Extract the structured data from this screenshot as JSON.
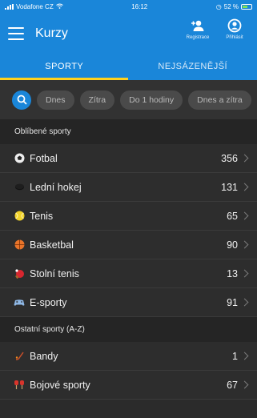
{
  "status_bar": {
    "carrier": "Vodafone CZ",
    "time": "16:12",
    "battery": "52 %"
  },
  "app_bar": {
    "title": "Kurzy",
    "register_label": "Registrace",
    "login_label": "Přihlásit"
  },
  "tabs": [
    {
      "label": "SPORTY",
      "active": true
    },
    {
      "label": "NEJSÁZENĚJŠÍ",
      "active": false
    }
  ],
  "filters": [
    "Dnes",
    "Zítra",
    "Do 1 hodiny",
    "Dnes a zítra"
  ],
  "favorite_sports": {
    "header": "Oblíbené sporty",
    "items": [
      {
        "label": "Fotbal",
        "count": "356",
        "icon": "soccer-ball-icon"
      },
      {
        "label": "Lední hokej",
        "count": "131",
        "icon": "hockey-puck-icon"
      },
      {
        "label": "Tenis",
        "count": "65",
        "icon": "tennis-ball-icon"
      },
      {
        "label": "Basketbal",
        "count": "90",
        "icon": "basketball-icon"
      },
      {
        "label": "Stolní tenis",
        "count": "13",
        "icon": "table-tennis-icon"
      },
      {
        "label": "E-sporty",
        "count": "91",
        "icon": "gamepad-icon"
      }
    ]
  },
  "other_sports": {
    "header": "Ostatní sporty (A-Z)",
    "items": [
      {
        "label": "Bandy",
        "count": "1",
        "icon": "bandy-stick-icon"
      },
      {
        "label": "Bojové sporty",
        "count": "67",
        "icon": "boxing-gloves-icon"
      }
    ]
  },
  "colors": {
    "accent": "#1a86d9",
    "tab_indicator": "#ffd21f",
    "background": "#2b2b2b"
  }
}
